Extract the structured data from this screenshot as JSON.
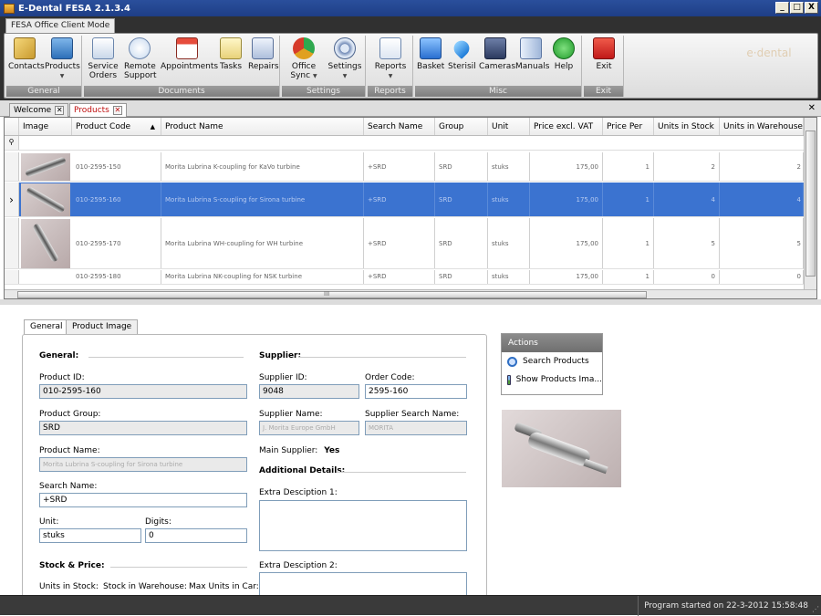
{
  "window": {
    "title": "E-Dental FESA 2.1.3.4",
    "min": "_",
    "max": "□",
    "close": "X"
  },
  "mode_tab": "FESA Office Client Mode",
  "ribbon": {
    "groups": [
      "General",
      "Documents",
      "Settings",
      "Reports",
      "Misc",
      "Exit"
    ],
    "buttons": {
      "contacts": "Contacts",
      "products": "Products",
      "service_orders": "Service Orders",
      "remote_support": "Remote Support",
      "appointments": "Appointments",
      "tasks": "Tasks",
      "repairs": "Repairs",
      "office_sync": "Office Sync",
      "settings": "Settings",
      "reports": "Reports",
      "basket": "Basket",
      "sterisil": "Sterisil",
      "cameras": "Cameras",
      "manuals": "Manuals",
      "help": "Help",
      "exit": "Exit"
    },
    "icon_names": [
      "contacts-icon",
      "products-icon",
      "service-orders-icon",
      "remote-support-icon",
      "appointments-icon",
      "tasks-icon",
      "repairs-icon",
      "office-sync-icon",
      "settings-icon",
      "reports-icon",
      "basket-icon",
      "sterisil-icon",
      "cameras-icon",
      "manuals-icon",
      "help-icon",
      "exit-icon"
    ]
  },
  "doc_tabs": [
    {
      "label": "Welcome"
    },
    {
      "label": "Products"
    }
  ],
  "grid": {
    "columns": [
      "Image",
      "Product Code",
      "Product Name",
      "Search Name",
      "Group",
      "Unit",
      "Price excl. VAT",
      "Price Per",
      "Units in Stock",
      "Units in Warehouse"
    ],
    "rows": [
      {
        "code": "010-2595-150",
        "name": "Morita Lubrina K-coupling for KaVo turbine",
        "search": "+SRD",
        "group": "SRD",
        "unit": "stuks",
        "price": "175,00",
        "per": "1",
        "stock": "2",
        "warehouse": "2"
      },
      {
        "code": "010-2595-160",
        "name": "Morita Lubrina S-coupling for Sirona turbine",
        "search": "+SRD",
        "group": "SRD",
        "unit": "stuks",
        "price": "175,00",
        "per": "1",
        "stock": "4",
        "warehouse": "4"
      },
      {
        "code": "010-2595-170",
        "name": "Morita Lubrina WH-coupling for WH turbine",
        "search": "+SRD",
        "group": "SRD",
        "unit": "stuks",
        "price": "175,00",
        "per": "1",
        "stock": "5",
        "warehouse": "5"
      },
      {
        "code": "010-2595-180",
        "name": "Morita Lubrina NK-coupling for NSK turbine",
        "search": "+SRD",
        "group": "SRD",
        "unit": "stuks",
        "price": "175,00",
        "per": "1",
        "stock": "0",
        "warehouse": "0"
      }
    ],
    "selected_row_marker": "›",
    "hscroll_grip": "III",
    "sort_arrow": "▲"
  },
  "detail_tabs": [
    "General",
    "Product Image"
  ],
  "general": {
    "section": "General:",
    "product_id_label": "Product ID:",
    "product_id": "010-2595-160",
    "product_group_label": "Product Group:",
    "product_group": "SRD",
    "product_name_label": "Product Name:",
    "product_name": "Morita Lubrina S-coupling for Sirona turbine",
    "search_name_label": "Search Name:",
    "search_name": "+SRD",
    "unit_label": "Unit:",
    "unit": "stuks",
    "digits_label": "Digits:",
    "digits": "0",
    "stock_section": "Stock & Price:",
    "units_in_stock_label": "Units in Stock:",
    "stock_in_warehouse_label": "Stock in Warehouse:",
    "max_units_in_car_label": "Max Units in Car:"
  },
  "supplier": {
    "section": "Supplier:",
    "supplier_id_label": "Supplier ID:",
    "supplier_id": "9048",
    "order_code_label": "Order Code:",
    "order_code": "2595-160",
    "supplier_name_label": "Supplier Name:",
    "supplier_name": "J. Morita Europe GmbH",
    "supplier_search_name_label": "Supplier Search Name:",
    "supplier_search_name": "MORITA",
    "main_supplier_label": "Main Supplier:",
    "main_supplier": "Yes",
    "additional_section": "Additional Details:",
    "extra1_label": "Extra Desciption 1:",
    "extra2_label": "Extra Desciption 2:"
  },
  "actions": {
    "title": "Actions",
    "items": [
      "Search Products",
      "Show Products Ima..."
    ]
  },
  "status": {
    "text": "Program started on 22-3-2012 15:58:48"
  },
  "colors": {
    "selection": "#3b73d0",
    "title_bar": "#2a4f9c",
    "exit_red": "#d02020",
    "active_tab_text": "#c01010"
  }
}
